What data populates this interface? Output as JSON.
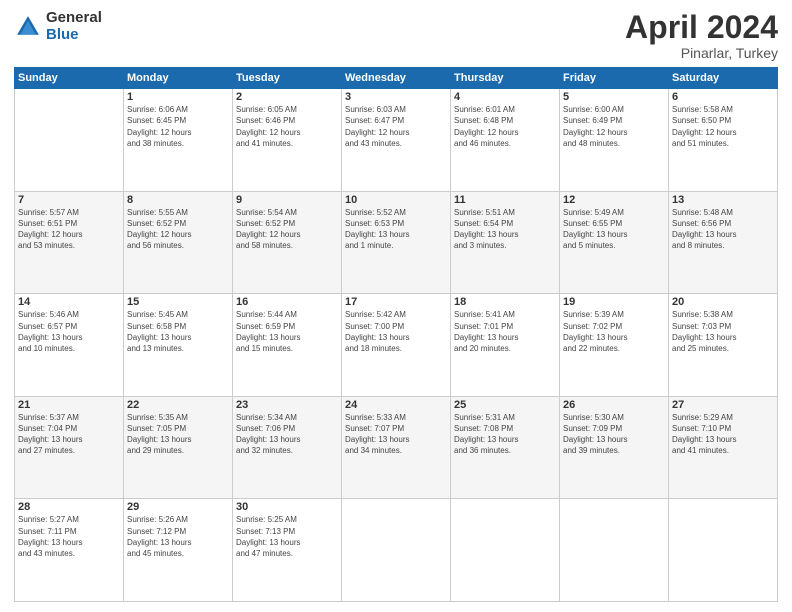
{
  "logo": {
    "general": "General",
    "blue": "Blue"
  },
  "header": {
    "month": "April 2024",
    "location": "Pinarlar, Turkey"
  },
  "weekdays": [
    "Sunday",
    "Monday",
    "Tuesday",
    "Wednesday",
    "Thursday",
    "Friday",
    "Saturday"
  ],
  "weeks": [
    [
      {
        "day": "",
        "content": ""
      },
      {
        "day": "1",
        "content": "Sunrise: 6:06 AM\nSunset: 6:45 PM\nDaylight: 12 hours\nand 38 minutes."
      },
      {
        "day": "2",
        "content": "Sunrise: 6:05 AM\nSunset: 6:46 PM\nDaylight: 12 hours\nand 41 minutes."
      },
      {
        "day": "3",
        "content": "Sunrise: 6:03 AM\nSunset: 6:47 PM\nDaylight: 12 hours\nand 43 minutes."
      },
      {
        "day": "4",
        "content": "Sunrise: 6:01 AM\nSunset: 6:48 PM\nDaylight: 12 hours\nand 46 minutes."
      },
      {
        "day": "5",
        "content": "Sunrise: 6:00 AM\nSunset: 6:49 PM\nDaylight: 12 hours\nand 48 minutes."
      },
      {
        "day": "6",
        "content": "Sunrise: 5:58 AM\nSunset: 6:50 PM\nDaylight: 12 hours\nand 51 minutes."
      }
    ],
    [
      {
        "day": "7",
        "content": "Sunrise: 5:57 AM\nSunset: 6:51 PM\nDaylight: 12 hours\nand 53 minutes."
      },
      {
        "day": "8",
        "content": "Sunrise: 5:55 AM\nSunset: 6:52 PM\nDaylight: 12 hours\nand 56 minutes."
      },
      {
        "day": "9",
        "content": "Sunrise: 5:54 AM\nSunset: 6:52 PM\nDaylight: 12 hours\nand 58 minutes."
      },
      {
        "day": "10",
        "content": "Sunrise: 5:52 AM\nSunset: 6:53 PM\nDaylight: 13 hours\nand 1 minute."
      },
      {
        "day": "11",
        "content": "Sunrise: 5:51 AM\nSunset: 6:54 PM\nDaylight: 13 hours\nand 3 minutes."
      },
      {
        "day": "12",
        "content": "Sunrise: 5:49 AM\nSunset: 6:55 PM\nDaylight: 13 hours\nand 5 minutes."
      },
      {
        "day": "13",
        "content": "Sunrise: 5:48 AM\nSunset: 6:56 PM\nDaylight: 13 hours\nand 8 minutes."
      }
    ],
    [
      {
        "day": "14",
        "content": "Sunrise: 5:46 AM\nSunset: 6:57 PM\nDaylight: 13 hours\nand 10 minutes."
      },
      {
        "day": "15",
        "content": "Sunrise: 5:45 AM\nSunset: 6:58 PM\nDaylight: 13 hours\nand 13 minutes."
      },
      {
        "day": "16",
        "content": "Sunrise: 5:44 AM\nSunset: 6:59 PM\nDaylight: 13 hours\nand 15 minutes."
      },
      {
        "day": "17",
        "content": "Sunrise: 5:42 AM\nSunset: 7:00 PM\nDaylight: 13 hours\nand 18 minutes."
      },
      {
        "day": "18",
        "content": "Sunrise: 5:41 AM\nSunset: 7:01 PM\nDaylight: 13 hours\nand 20 minutes."
      },
      {
        "day": "19",
        "content": "Sunrise: 5:39 AM\nSunset: 7:02 PM\nDaylight: 13 hours\nand 22 minutes."
      },
      {
        "day": "20",
        "content": "Sunrise: 5:38 AM\nSunset: 7:03 PM\nDaylight: 13 hours\nand 25 minutes."
      }
    ],
    [
      {
        "day": "21",
        "content": "Sunrise: 5:37 AM\nSunset: 7:04 PM\nDaylight: 13 hours\nand 27 minutes."
      },
      {
        "day": "22",
        "content": "Sunrise: 5:35 AM\nSunset: 7:05 PM\nDaylight: 13 hours\nand 29 minutes."
      },
      {
        "day": "23",
        "content": "Sunrise: 5:34 AM\nSunset: 7:06 PM\nDaylight: 13 hours\nand 32 minutes."
      },
      {
        "day": "24",
        "content": "Sunrise: 5:33 AM\nSunset: 7:07 PM\nDaylight: 13 hours\nand 34 minutes."
      },
      {
        "day": "25",
        "content": "Sunrise: 5:31 AM\nSunset: 7:08 PM\nDaylight: 13 hours\nand 36 minutes."
      },
      {
        "day": "26",
        "content": "Sunrise: 5:30 AM\nSunset: 7:09 PM\nDaylight: 13 hours\nand 39 minutes."
      },
      {
        "day": "27",
        "content": "Sunrise: 5:29 AM\nSunset: 7:10 PM\nDaylight: 13 hours\nand 41 minutes."
      }
    ],
    [
      {
        "day": "28",
        "content": "Sunrise: 5:27 AM\nSunset: 7:11 PM\nDaylight: 13 hours\nand 43 minutes."
      },
      {
        "day": "29",
        "content": "Sunrise: 5:26 AM\nSunset: 7:12 PM\nDaylight: 13 hours\nand 45 minutes."
      },
      {
        "day": "30",
        "content": "Sunrise: 5:25 AM\nSunset: 7:13 PM\nDaylight: 13 hours\nand 47 minutes."
      },
      {
        "day": "",
        "content": ""
      },
      {
        "day": "",
        "content": ""
      },
      {
        "day": "",
        "content": ""
      },
      {
        "day": "",
        "content": ""
      }
    ]
  ]
}
